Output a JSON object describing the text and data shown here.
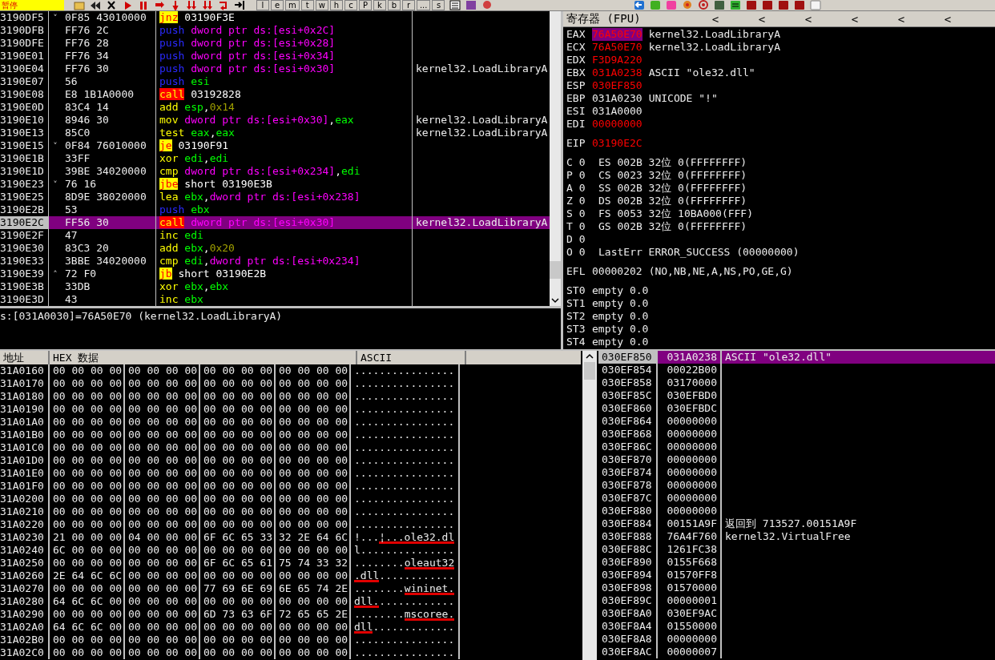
{
  "toolbar": {
    "status": "暂停",
    "buttons": [
      "l",
      "e",
      "m",
      "t",
      "w",
      "h",
      "c",
      "P",
      "k",
      "b",
      "r",
      "...",
      "s"
    ]
  },
  "disassembly": {
    "rows": [
      {
        "address": "3190DF5",
        "marker": "˅",
        "hex": "0F85 43010000",
        "mnemonic": {
          "text": "jnz",
          "kind": "jump"
        },
        "operands": [
          {
            "text": "03190F3E",
            "kind": "addr"
          }
        ],
        "selected": false
      },
      {
        "address": "3190DFB",
        "hex": "FF76 2C",
        "mnemonic": {
          "text": "push",
          "kind": "push"
        },
        "operands": [
          {
            "text": "dword ptr ds:[esi+0x2C]",
            "kind": "mem"
          }
        ],
        "selected": false
      },
      {
        "address": "3190DFE",
        "hex": "FF76 28",
        "mnemonic": {
          "text": "push",
          "kind": "push"
        },
        "operands": [
          {
            "text": "dword ptr ds:[esi+0x28]",
            "kind": "mem"
          }
        ],
        "selected": false
      },
      {
        "address": "3190E01",
        "hex": "FF76 34",
        "mnemonic": {
          "text": "push",
          "kind": "push"
        },
        "operands": [
          {
            "text": "dword ptr ds:[esi+0x34]",
            "kind": "mem"
          }
        ],
        "selected": false
      },
      {
        "address": "3190E04",
        "hex": "FF76 30",
        "mnemonic": {
          "text": "push",
          "kind": "push"
        },
        "operands": [
          {
            "text": "dword ptr ds:[esi+0x30]",
            "kind": "mem"
          }
        ],
        "comment": "kernel32.LoadLibraryA",
        "selected": false
      },
      {
        "address": "3190E07",
        "hex": "56",
        "mnemonic": {
          "text": "push",
          "kind": "push"
        },
        "operands": [
          {
            "text": "esi",
            "kind": "reg"
          }
        ],
        "selected": false
      },
      {
        "address": "3190E08",
        "hex": "E8 1B1A0000",
        "mnemonic": {
          "text": "call",
          "kind": "call"
        },
        "operands": [
          {
            "text": "03192828",
            "kind": "addr"
          }
        ],
        "selected": false
      },
      {
        "address": "3190E0D",
        "hex": "83C4 14",
        "mnemonic": {
          "text": "add",
          "kind": "plain"
        },
        "operands": [
          {
            "text": "esp",
            "kind": "reg"
          },
          {
            "text": ",",
            "kind": "sep"
          },
          {
            "text": "0x14",
            "kind": "imm"
          }
        ],
        "selected": false
      },
      {
        "address": "3190E10",
        "hex": "8946 30",
        "mnemonic": {
          "text": "mov",
          "kind": "plain"
        },
        "operands": [
          {
            "text": "dword ptr ds:[esi+0x30]",
            "kind": "mem"
          },
          {
            "text": ",",
            "kind": "sep"
          },
          {
            "text": "eax",
            "kind": "reg"
          }
        ],
        "comment": "kernel32.LoadLibraryA",
        "selected": false
      },
      {
        "address": "3190E13",
        "hex": "85C0",
        "mnemonic": {
          "text": "test",
          "kind": "plain"
        },
        "operands": [
          {
            "text": "eax",
            "kind": "reg"
          },
          {
            "text": ",",
            "kind": "sep"
          },
          {
            "text": "eax",
            "kind": "reg"
          }
        ],
        "comment": "kernel32.LoadLibraryA",
        "selected": false
      },
      {
        "address": "3190E15",
        "marker": "˅",
        "hex": "0F84 76010000",
        "mnemonic": {
          "text": "je",
          "kind": "jump"
        },
        "operands": [
          {
            "text": "03190F91",
            "kind": "addr"
          }
        ],
        "selected": false
      },
      {
        "address": "3190E1B",
        "hex": "33FF",
        "mnemonic": {
          "text": "xor",
          "kind": "plain"
        },
        "operands": [
          {
            "text": "edi",
            "kind": "reg"
          },
          {
            "text": ",",
            "kind": "sep"
          },
          {
            "text": "edi",
            "kind": "reg"
          }
        ],
        "selected": false
      },
      {
        "address": "3190E1D",
        "hex": "39BE 34020000",
        "mnemonic": {
          "text": "cmp",
          "kind": "plain"
        },
        "operands": [
          {
            "text": "dword ptr ds:[esi+0x234]",
            "kind": "mem"
          },
          {
            "text": ",",
            "kind": "sep"
          },
          {
            "text": "edi",
            "kind": "reg"
          }
        ],
        "selected": false
      },
      {
        "address": "3190E23",
        "marker": "˅",
        "hex": "76 16",
        "mnemonic": {
          "text": "jbe",
          "kind": "jump"
        },
        "operands": [
          {
            "text": "short 03190E3B",
            "kind": "addr"
          }
        ],
        "selected": false
      },
      {
        "address": "3190E25",
        "hex": "8D9E 38020000",
        "mnemonic": {
          "text": "lea",
          "kind": "plain"
        },
        "operands": [
          {
            "text": "ebx",
            "kind": "reg"
          },
          {
            "text": ",",
            "kind": "sep"
          },
          {
            "text": "dword ptr ds:[esi+0x238]",
            "kind": "mem"
          }
        ],
        "selected": false
      },
      {
        "address": "3190E2B",
        "hex": "53",
        "mnemonic": {
          "text": "push",
          "kind": "push"
        },
        "operands": [
          {
            "text": "ebx",
            "kind": "reg"
          }
        ],
        "selected": false
      },
      {
        "address": "3190E2C",
        "hex": "FF56 30",
        "mnemonic": {
          "text": "call",
          "kind": "call"
        },
        "operands": [
          {
            "text": "dword ptr ds:[esi+0x30]",
            "kind": "mem"
          }
        ],
        "comment": "kernel32.LoadLibraryA",
        "selected": true
      },
      {
        "address": "3190E2F",
        "hex": "47",
        "mnemonic": {
          "text": "inc",
          "kind": "plain"
        },
        "operands": [
          {
            "text": "edi",
            "kind": "reg"
          }
        ],
        "selected": false
      },
      {
        "address": "3190E30",
        "hex": "83C3 20",
        "mnemonic": {
          "text": "add",
          "kind": "plain"
        },
        "operands": [
          {
            "text": "ebx",
            "kind": "reg"
          },
          {
            "text": ",",
            "kind": "sep"
          },
          {
            "text": "0x20",
            "kind": "imm"
          }
        ],
        "selected": false
      },
      {
        "address": "3190E33",
        "hex": "3BBE 34020000",
        "mnemonic": {
          "text": "cmp",
          "kind": "plain"
        },
        "operands": [
          {
            "text": "edi",
            "kind": "reg"
          },
          {
            "text": ",",
            "kind": "sep"
          },
          {
            "text": "dword ptr ds:[esi+0x234]",
            "kind": "mem"
          }
        ],
        "selected": false
      },
      {
        "address": "3190E39",
        "marker": "˄",
        "hex": "72 F0",
        "mnemonic": {
          "text": "jb",
          "kind": "jump"
        },
        "operands": [
          {
            "text": "short 03190E2B",
            "kind": "addr"
          }
        ],
        "selected": false
      },
      {
        "address": "3190E3B",
        "hex": "33DB",
        "mnemonic": {
          "text": "xor",
          "kind": "plain"
        },
        "operands": [
          {
            "text": "ebx",
            "kind": "reg"
          },
          {
            "text": ",",
            "kind": "sep"
          },
          {
            "text": "ebx",
            "kind": "reg"
          }
        ],
        "selected": false
      },
      {
        "address": "3190E3D",
        "hex": "43",
        "mnemonic": {
          "text": "inc",
          "kind": "plain"
        },
        "operands": [
          {
            "text": "ebx",
            "kind": "reg"
          }
        ],
        "selected": false
      }
    ]
  },
  "info_line": "s:[031A0030]=76A50E70 (kernel32.LoadLibraryA)",
  "registers": {
    "title": "寄存器 (FPU)",
    "nav_buttons": [
      "<",
      "<",
      "<",
      "<",
      "<",
      "<"
    ],
    "general": [
      {
        "name": "EAX",
        "value": "76A50E70",
        "changed": true,
        "selected": true,
        "comment": "kernel32.LoadLibraryA"
      },
      {
        "name": "ECX",
        "value": "76A50E70",
        "changed": true,
        "selected": false,
        "comment": "kernel32.LoadLibraryA"
      },
      {
        "name": "EDX",
        "value": "F3D9A220",
        "changed": true,
        "selected": false
      },
      {
        "name": "EBX",
        "value": "031A0238",
        "changed": true,
        "selected": false,
        "comment": "ASCII \"ole32.dll\""
      },
      {
        "name": "ESP",
        "value": "030EF850",
        "changed": true,
        "selected": false
      },
      {
        "name": "EBP",
        "value": "031A0230",
        "changed": false,
        "selected": false,
        "comment": "UNICODE \"!\""
      },
      {
        "name": "ESI",
        "value": "031A0000",
        "changed": false,
        "selected": false
      },
      {
        "name": "EDI",
        "value": "00000000",
        "changed": true,
        "selected": false
      }
    ],
    "eip": {
      "name": "EIP",
      "value": "03190E2C",
      "changed": true,
      "selected": false
    },
    "flags": [
      {
        "flag": "C 0",
        "info": "ES 002B 32位 0(FFFFFFFF)"
      },
      {
        "flag": "P 0",
        "info": "CS 0023 32位 0(FFFFFFFF)"
      },
      {
        "flag": "A 0",
        "info": "SS 002B 32位 0(FFFFFFFF)"
      },
      {
        "flag": "Z 0",
        "info": "DS 002B 32位 0(FFFFFFFF)"
      },
      {
        "flag": "S 0",
        "info": "FS 0053 32位 10BA000(FFF)"
      },
      {
        "flag": "T 0",
        "info": "GS 002B 32位 0(FFFFFFFF)"
      },
      {
        "flag": "D 0"
      },
      {
        "flag": "O 0",
        "info": "LastErr ERROR_SUCCESS (00000000)"
      }
    ],
    "efl": {
      "name": "EFL",
      "value": "00000202",
      "info": "(NO,NB,NE,A,NS,PO,GE,G)"
    },
    "fpu": [
      {
        "name": "ST0",
        "info": "empty 0.0"
      },
      {
        "name": "ST1",
        "info": "empty 0.0"
      },
      {
        "name": "ST2",
        "info": "empty 0.0"
      },
      {
        "name": "ST3",
        "info": "empty 0.0"
      },
      {
        "name": "ST4",
        "info": "empty 0.0"
      }
    ]
  },
  "dump": {
    "columns": [
      "地址",
      "HEX 数据",
      "ASCII"
    ],
    "rows": [
      {
        "address": "31A0160",
        "bytes": "00 00 00 00 00 00 00 00 00 00 00 00 00 00 00 00",
        "ascii": [
          {
            "text": "................",
            "underlined": false
          }
        ]
      },
      {
        "address": "31A0170",
        "bytes": "00 00 00 00 00 00 00 00 00 00 00 00 00 00 00 00",
        "ascii": [
          {
            "text": "................",
            "underlined": false
          }
        ]
      },
      {
        "address": "31A0180",
        "bytes": "00 00 00 00 00 00 00 00 00 00 00 00 00 00 00 00",
        "ascii": [
          {
            "text": "................",
            "underlined": false
          }
        ]
      },
      {
        "address": "31A0190",
        "bytes": "00 00 00 00 00 00 00 00 00 00 00 00 00 00 00 00",
        "ascii": [
          {
            "text": "................",
            "underlined": false
          }
        ]
      },
      {
        "address": "31A01A0",
        "bytes": "00 00 00 00 00 00 00 00 00 00 00 00 00 00 00 00",
        "ascii": [
          {
            "text": "................",
            "underlined": false
          }
        ]
      },
      {
        "address": "31A01B0",
        "bytes": "00 00 00 00 00 00 00 00 00 00 00 00 00 00 00 00",
        "ascii": [
          {
            "text": "................",
            "underlined": false
          }
        ]
      },
      {
        "address": "31A01C0",
        "bytes": "00 00 00 00 00 00 00 00 00 00 00 00 00 00 00 00",
        "ascii": [
          {
            "text": "................",
            "underlined": false
          }
        ]
      },
      {
        "address": "31A01D0",
        "bytes": "00 00 00 00 00 00 00 00 00 00 00 00 00 00 00 00",
        "ascii": [
          {
            "text": "................",
            "underlined": false
          }
        ]
      },
      {
        "address": "31A01E0",
        "bytes": "00 00 00 00 00 00 00 00 00 00 00 00 00 00 00 00",
        "ascii": [
          {
            "text": "................",
            "underlined": false
          }
        ]
      },
      {
        "address": "31A01F0",
        "bytes": "00 00 00 00 00 00 00 00 00 00 00 00 00 00 00 00",
        "ascii": [
          {
            "text": "................",
            "underlined": false
          }
        ]
      },
      {
        "address": "31A0200",
        "bytes": "00 00 00 00 00 00 00 00 00 00 00 00 00 00 00 00",
        "ascii": [
          {
            "text": "................",
            "underlined": false
          }
        ]
      },
      {
        "address": "31A0210",
        "bytes": "00 00 00 00 00 00 00 00 00 00 00 00 00 00 00 00",
        "ascii": [
          {
            "text": "................",
            "underlined": false
          }
        ]
      },
      {
        "address": "31A0220",
        "bytes": "00 00 00 00 00 00 00 00 00 00 00 00 00 00 00 00",
        "ascii": [
          {
            "text": "................",
            "underlined": false
          }
        ]
      },
      {
        "address": "31A0230",
        "bytes": "21 00 00 00 04 00 00 00 6F 6C 65 33 32 2E 64 6C",
        "ascii": [
          {
            "text": "!...",
            "underlined": false
          },
          {
            "text": "¦...ole32.dl",
            "underlined": true
          }
        ]
      },
      {
        "address": "31A0240",
        "bytes": "6C 00 00 00 00 00 00 00 00 00 00 00 00 00 00 00",
        "ascii": [
          {
            "text": "l...............",
            "underlined": false
          }
        ]
      },
      {
        "address": "31A0250",
        "bytes": "00 00 00 00 00 00 00 00 6F 6C 65 61 75 74 33 32",
        "ascii": [
          {
            "text": "........",
            "underlined": false
          },
          {
            "text": "oleaut32",
            "underlined": true
          }
        ]
      },
      {
        "address": "31A0260",
        "bytes": "2E 64 6C 6C 00 00 00 00 00 00 00 00 00 00 00 00",
        "ascii": [
          {
            "text": ".dll",
            "underlined": true
          },
          {
            "text": "............",
            "underlined": false
          }
        ]
      },
      {
        "address": "31A0270",
        "bytes": "00 00 00 00 00 00 00 00 77 69 6E 69 6E 65 74 2E",
        "ascii": [
          {
            "text": "........",
            "underlined": false
          },
          {
            "text": "wininet.",
            "underlined": true
          }
        ]
      },
      {
        "address": "31A0280",
        "bytes": "64 6C 6C 00 00 00 00 00 00 00 00 00 00 00 00 00",
        "ascii": [
          {
            "text": "dll.",
            "underlined": true
          },
          {
            "text": "............",
            "underlined": false
          }
        ]
      },
      {
        "address": "31A0290",
        "bytes": "00 00 00 00 00 00 00 00 6D 73 63 6F 72 65 65 2E",
        "ascii": [
          {
            "text": "........",
            "underlined": false
          },
          {
            "text": "mscoree.",
            "underlined": true
          }
        ]
      },
      {
        "address": "31A02A0",
        "bytes": "64 6C 6C 00 00 00 00 00 00 00 00 00 00 00 00 00",
        "ascii": [
          {
            "text": "dll",
            "underlined": true
          },
          {
            "text": ".............",
            "underlined": false
          }
        ]
      },
      {
        "address": "31A02B0",
        "bytes": "00 00 00 00 00 00 00 00 00 00 00 00 00 00 00 00",
        "ascii": [
          {
            "text": "................",
            "underlined": false
          }
        ]
      },
      {
        "address": "31A02C0",
        "bytes": "00 00 00 00 00 00 00 00 00 00 00 00 00 00 00 00",
        "ascii": [
          {
            "text": "................",
            "underlined": false
          }
        ]
      }
    ]
  },
  "stack": {
    "rows": [
      {
        "address": "030EF850",
        "value": "031A0238",
        "comment": "ASCII \"ole32.dll\"",
        "selected": true
      },
      {
        "address": "030EF854",
        "value": "00022B00",
        "selected": false
      },
      {
        "address": "030EF858",
        "value": "03170000",
        "selected": false
      },
      {
        "address": "030EF85C",
        "value": "030EFBD0",
        "selected": false
      },
      {
        "address": "030EF860",
        "value": "030EFBDC",
        "selected": false
      },
      {
        "address": "030EF864",
        "value": "00000000",
        "selected": false
      },
      {
        "address": "030EF868",
        "value": "00000000",
        "selected": false
      },
      {
        "address": "030EF86C",
        "value": "00000000",
        "selected": false
      },
      {
        "address": "030EF870",
        "value": "00000000",
        "selected": false
      },
      {
        "address": "030EF874",
        "value": "00000000",
        "selected": false
      },
      {
        "address": "030EF878",
        "value": "00000000",
        "selected": false
      },
      {
        "address": "030EF87C",
        "value": "00000000",
        "selected": false
      },
      {
        "address": "030EF880",
        "value": "00000000",
        "selected": false
      },
      {
        "address": "030EF884",
        "value": "00151A9F",
        "comment": "返回到 713527.00151A9F",
        "selected": false
      },
      {
        "address": "030EF888",
        "value": "76A4F760",
        "comment": "kernel32.VirtualFree",
        "selected": false
      },
      {
        "address": "030EF88C",
        "value": "1261FC38",
        "selected": false
      },
      {
        "address": "030EF890",
        "value": "0155F668",
        "selected": false
      },
      {
        "address": "030EF894",
        "value": "01570FF8",
        "selected": false
      },
      {
        "address": "030EF898",
        "value": "01570000",
        "selected": false
      },
      {
        "address": "030EF89C",
        "value": "00000001",
        "selected": false
      },
      {
        "address": "030EF8A0",
        "value": "030EF9AC",
        "selected": false
      },
      {
        "address": "030EF8A4",
        "value": "01550000",
        "selected": false
      },
      {
        "address": "030EF8A8",
        "value": "00000000",
        "selected": false
      },
      {
        "address": "030EF8AC",
        "value": "00000007",
        "selected": false
      }
    ]
  }
}
